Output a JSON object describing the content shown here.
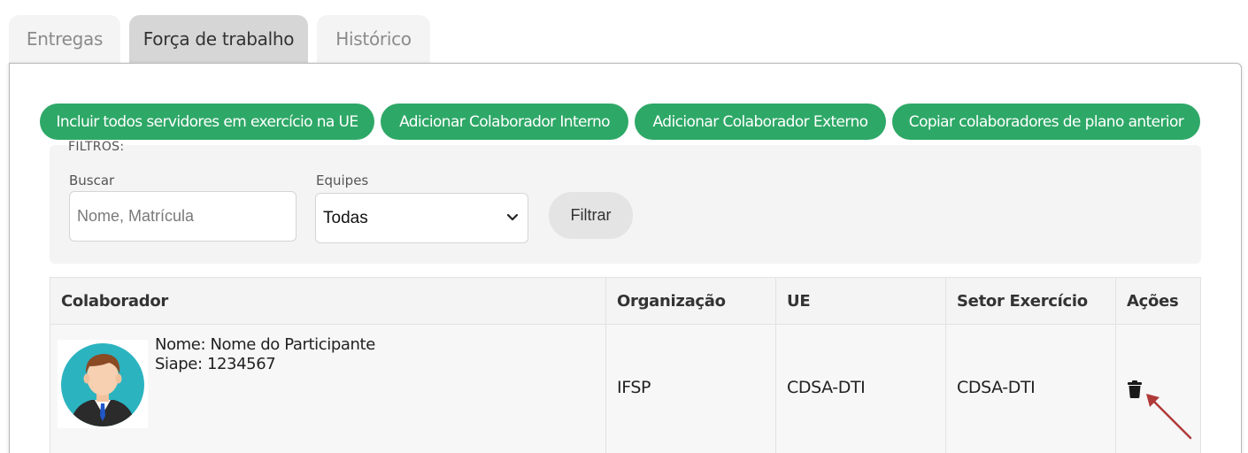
{
  "tabs": [
    {
      "label": "Entregas",
      "active": false
    },
    {
      "label": "Força de trabalho",
      "active": true
    },
    {
      "label": "Histórico",
      "active": false
    }
  ],
  "actions": {
    "include_all": "Incluir todos servidores em exercício na UE",
    "add_internal": "Adicionar Colaborador Interno",
    "add_external": "Adicionar Colaborador Externo",
    "copy_previous": "Copiar colaboradores de plano anterior"
  },
  "filters": {
    "title": "FILTROS:",
    "search_label": "Buscar",
    "search_placeholder": "Nome, Matrícula",
    "teams_label": "Equipes",
    "teams_selected": "Todas",
    "filter_button": "Filtrar"
  },
  "table": {
    "columns": [
      "Colaborador",
      "Organização",
      "UE",
      "Setor Exercício",
      "Ações"
    ],
    "rows": [
      {
        "name_line": "Nome: Nome do Participante",
        "siape_line": "Siape: 1234567",
        "organizacao": "IFSP",
        "ue": "CDSA-DTI",
        "setor": "CDSA-DTI",
        "action_icon": "trash-icon"
      }
    ]
  },
  "colors": {
    "accent_green": "#2ea867",
    "annotation_arrow": "#b03a3a"
  }
}
